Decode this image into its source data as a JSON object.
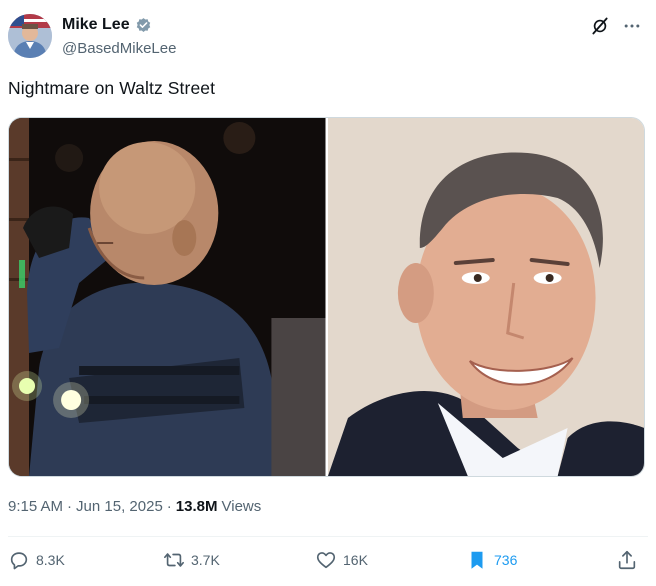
{
  "author": {
    "display_name": "Mike Lee",
    "handle": "@BasedMikeLee",
    "verified": true
  },
  "tweet": {
    "text": "Nightmare on Waltz Street"
  },
  "media": [
    {
      "subject": "masked-man-at-night"
    },
    {
      "subject": "smiling-man-in-suit"
    }
  ],
  "meta": {
    "time": "9:15 AM",
    "separator1": "·",
    "date": "Jun 15, 2025",
    "separator2": "·",
    "views_count": "13.8M",
    "views_label": "Views"
  },
  "actions": {
    "replies": "8.3K",
    "reposts": "3.7K",
    "likes": "16K",
    "bookmarks": "736"
  },
  "icons": {
    "verified": "verified-badge-icon",
    "grok": "grok-icon",
    "more": "more-icon",
    "reply": "reply-icon",
    "repost": "repost-icon",
    "like": "like-icon",
    "bookmark": "bookmark-icon",
    "share": "share-icon"
  },
  "colors": {
    "text_primary": "#0f1419",
    "text_secondary": "#536471",
    "accent": "#1d9bf0",
    "border": "#cfd9de"
  }
}
